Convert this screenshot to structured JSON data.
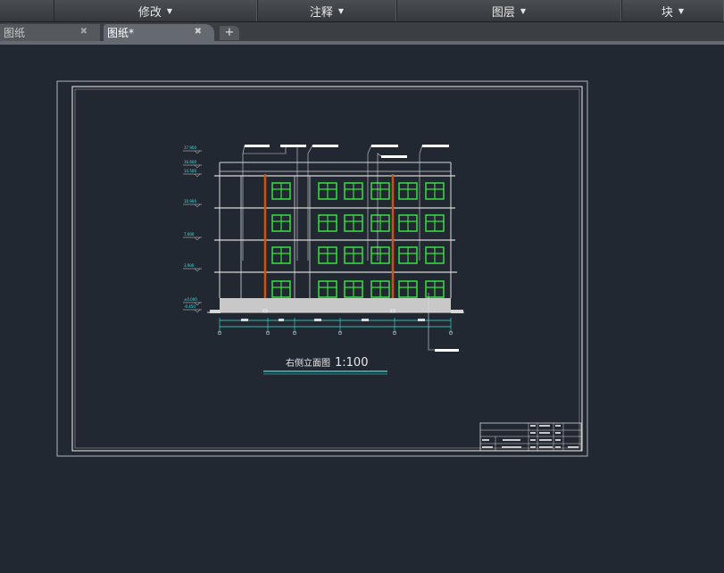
{
  "ribbon": {
    "panels": [
      {
        "label": "修改"
      },
      {
        "label": "注释"
      },
      {
        "label": "图层"
      },
      {
        "label": "块"
      }
    ]
  },
  "tabs": [
    {
      "label": "图纸",
      "active": false
    },
    {
      "label": "图纸*",
      "active": true
    }
  ],
  "add_tab": "+",
  "drawing": {
    "title": "右侧立面图",
    "scale": "1:100",
    "elevations": [
      "17.900",
      "16.600",
      "14.500",
      "10.900",
      "7.600",
      "3.900",
      "±0.000",
      "-0.450"
    ]
  },
  "colors": {
    "background": "#222831",
    "window_green": "#38e040",
    "pipe_orange": "#d05010",
    "line_white": "#d8d8d8",
    "dimension_cyan": "#40e0e0"
  }
}
